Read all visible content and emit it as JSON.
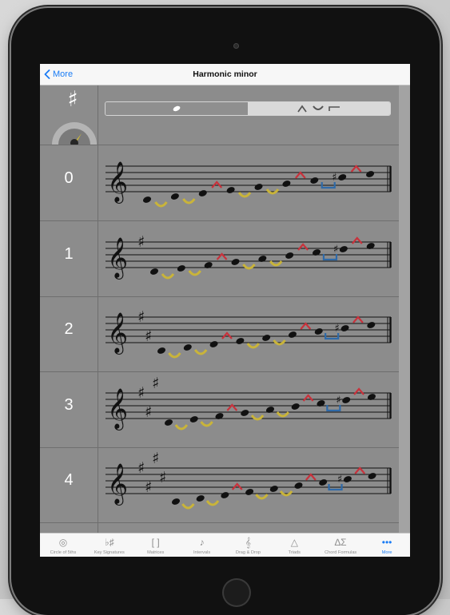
{
  "nav": {
    "back_label": "More",
    "title": "Harmonic minor"
  },
  "header": {
    "sharp_symbol": "♯"
  },
  "rows": [
    {
      "number": "0",
      "sharps": 0
    },
    {
      "number": "1",
      "sharps": 1
    },
    {
      "number": "2",
      "sharps": 2
    },
    {
      "number": "3",
      "sharps": 3
    },
    {
      "number": "4",
      "sharps": 4
    }
  ],
  "tabs": [
    {
      "label": "Circle of 5ths",
      "icon": "circle-of-fifths-icon",
      "active": false
    },
    {
      "label": "Key Signatures",
      "icon": "key-signatures-icon",
      "active": false
    },
    {
      "label": "Matrices",
      "icon": "matrices-icon",
      "active": false
    },
    {
      "label": "Intervals",
      "icon": "intervals-icon",
      "active": false
    },
    {
      "label": "Drag & Drop",
      "icon": "drag-drop-icon",
      "active": false
    },
    {
      "label": "Triads",
      "icon": "triads-icon",
      "active": false
    },
    {
      "label": "Chord Formulas",
      "icon": "chord-formulas-icon",
      "active": false
    },
    {
      "label": "More",
      "icon": "more-icon",
      "active": true
    }
  ],
  "colors": {
    "accent": "#1a7cf5",
    "half_step": "#c9b43a",
    "whole_step_leap": "#c8323c",
    "augmented_second": "#2f6aa8",
    "note": "#111111"
  }
}
